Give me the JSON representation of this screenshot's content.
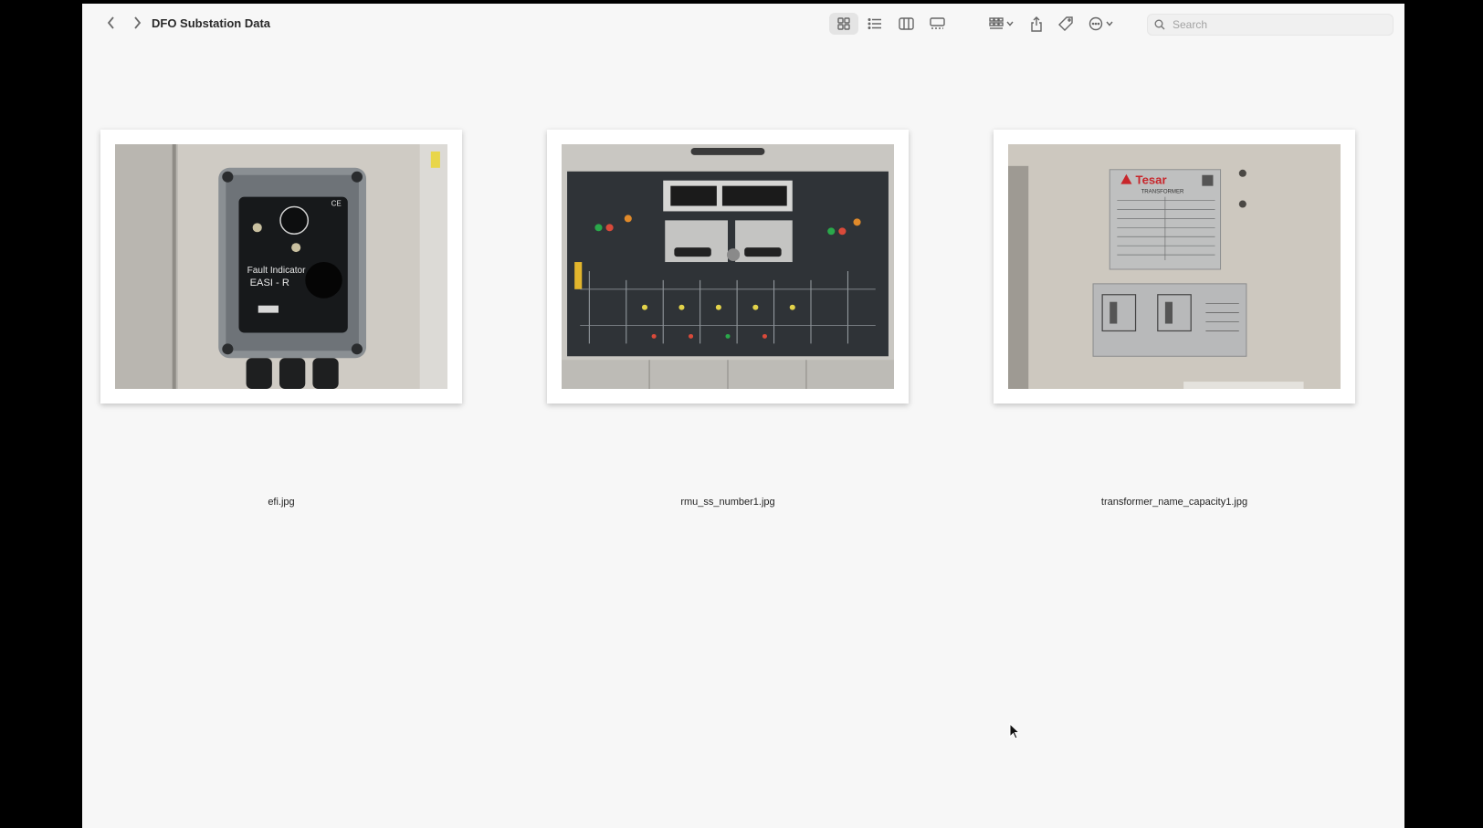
{
  "window": {
    "title": "DFO Substation Data"
  },
  "toolbar": {
    "back_icon": "chevron-left-icon",
    "forward_icon": "chevron-right-icon",
    "view_modes": [
      "icon-view",
      "list-view",
      "column-view",
      "gallery-view"
    ],
    "active_view": "icon-view",
    "group_icon": "group-grid-icon",
    "share_icon": "share-icon",
    "tag_icon": "tag-icon",
    "more_icon": "ellipsis-circle-icon",
    "search_placeholder": "Search"
  },
  "files": [
    {
      "name": "efi.jpg",
      "thumbnail": "fault-indicator-photo"
    },
    {
      "name": "rmu_ss_number1.jpg",
      "thumbnail": "rmu-panel-photo"
    },
    {
      "name": "transformer_name_capacity1.jpg",
      "thumbnail": "transformer-nameplate-photo"
    }
  ],
  "photo_text": {
    "efi_title": "Fault Indicator",
    "efi_model": "EASI - R",
    "efi_ce": "CE",
    "nameplate_brand": "Tesar",
    "nameplate_type": "TRANSFORMER"
  },
  "colors": {
    "window_bg": "#f7f7f7",
    "frame_bg": "#ffffff",
    "accent_red": "#c8262b"
  }
}
